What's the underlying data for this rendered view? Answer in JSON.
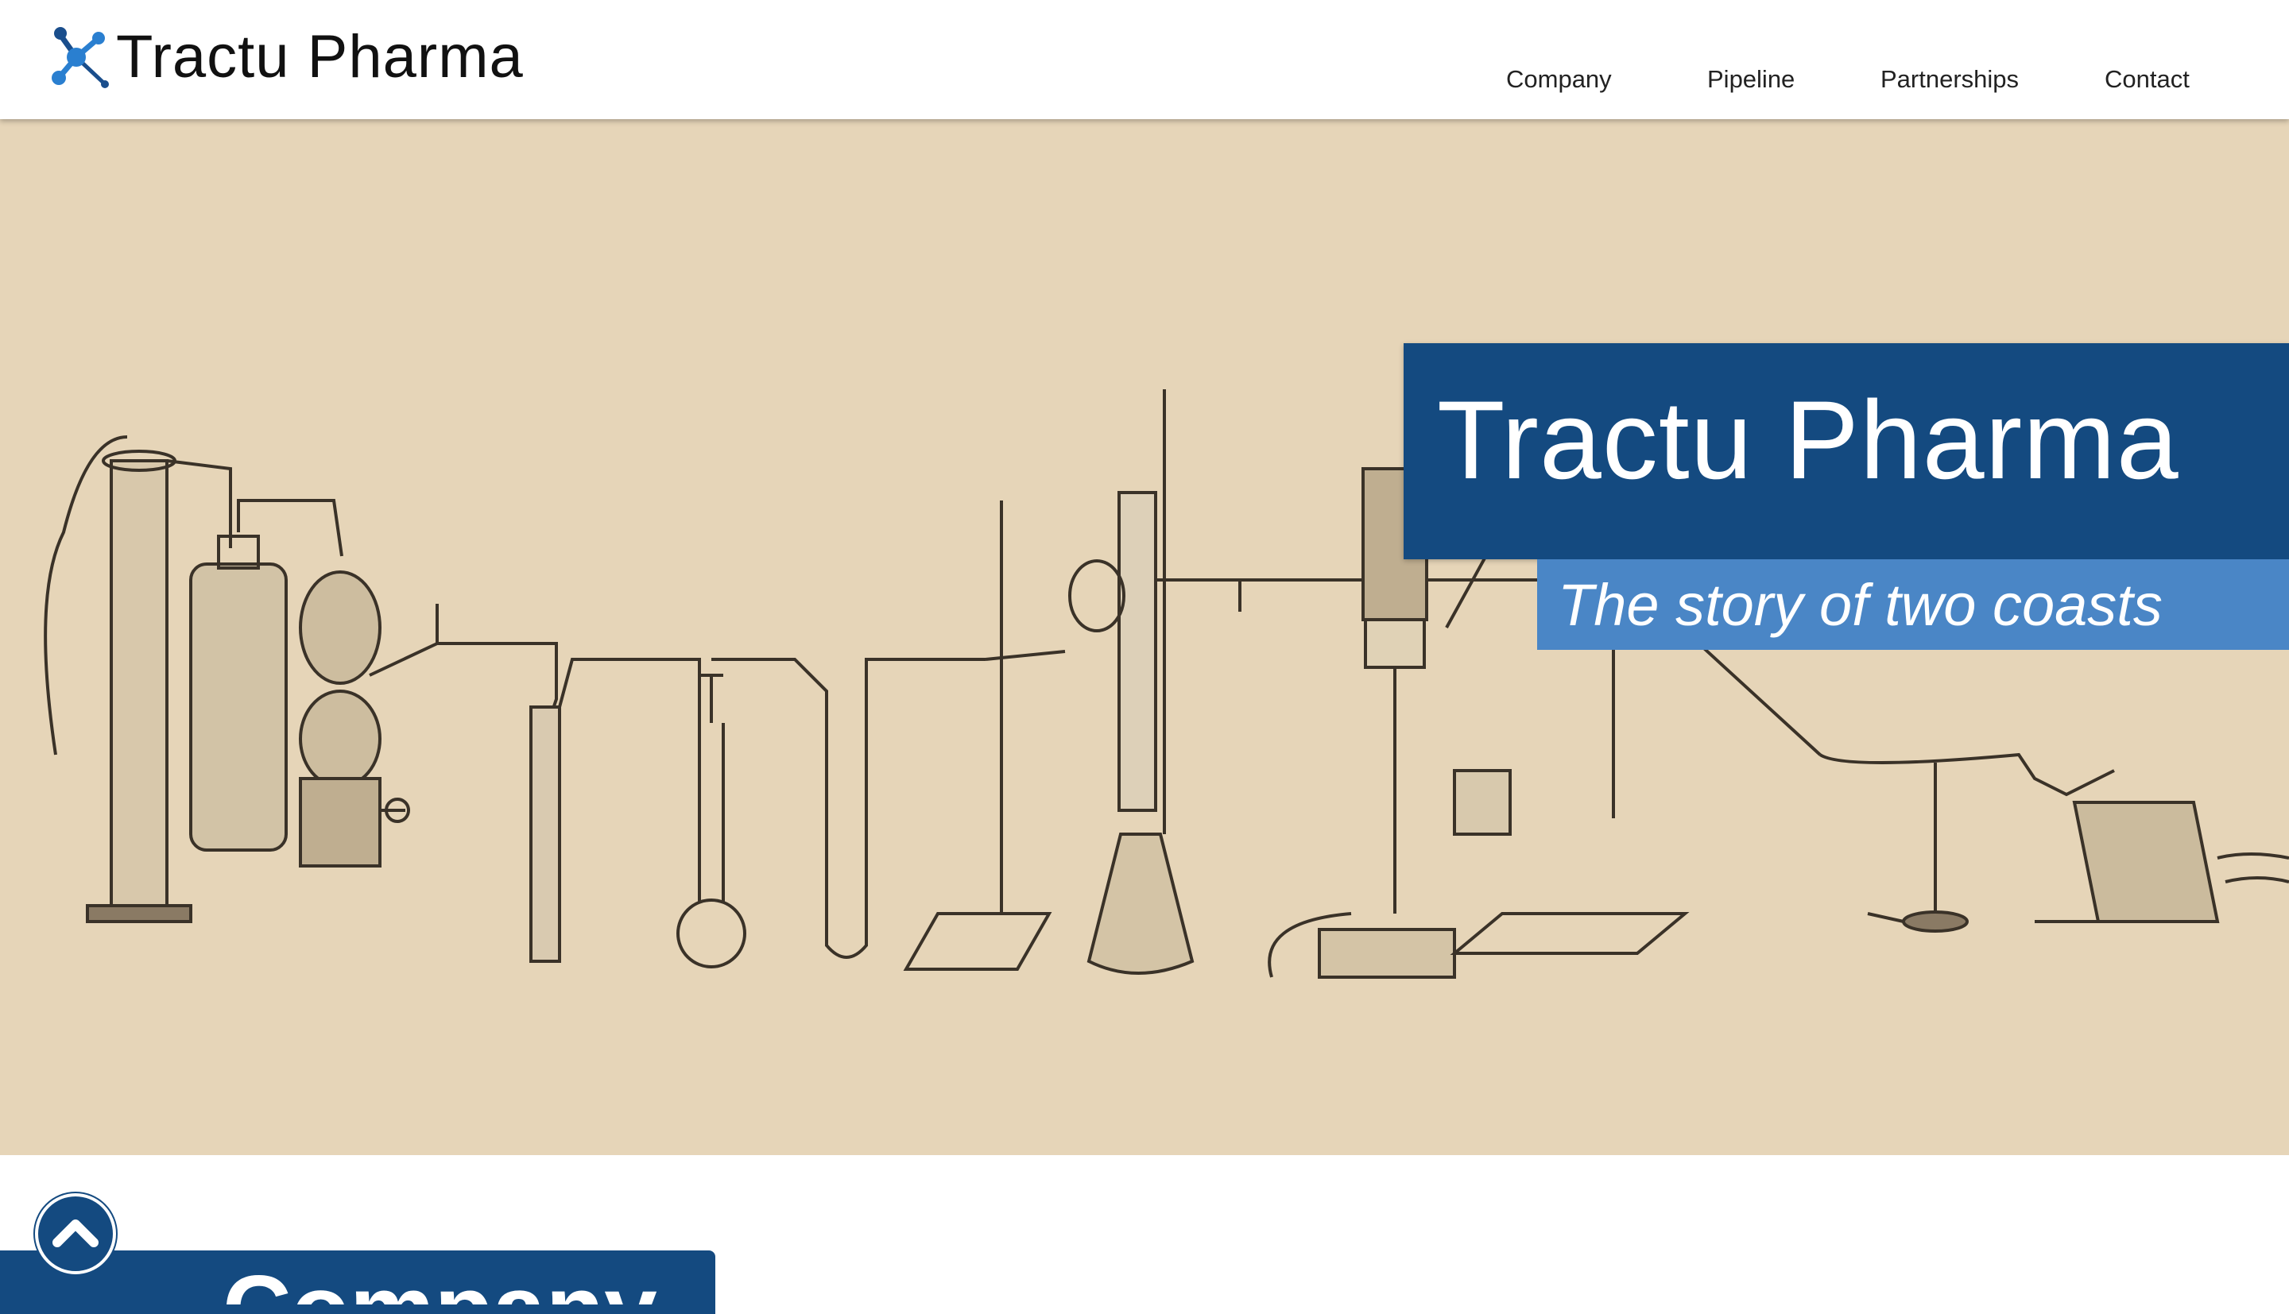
{
  "header": {
    "brand": "Tractu Pharma",
    "logo_icon": "molecule-icon",
    "nav": [
      "Company",
      "Pipeline",
      "Partnerships",
      "Contact"
    ]
  },
  "hero": {
    "title": "Tractu Pharma",
    "subtitle": "The story of two coasts"
  },
  "colors": {
    "primary_blue": "#144a80",
    "accent_blue": "#4a86c6",
    "hero_background": "#e6d5b8"
  },
  "section": {
    "heading": "Company"
  },
  "scroll_top_icon": "chevron-up-icon"
}
